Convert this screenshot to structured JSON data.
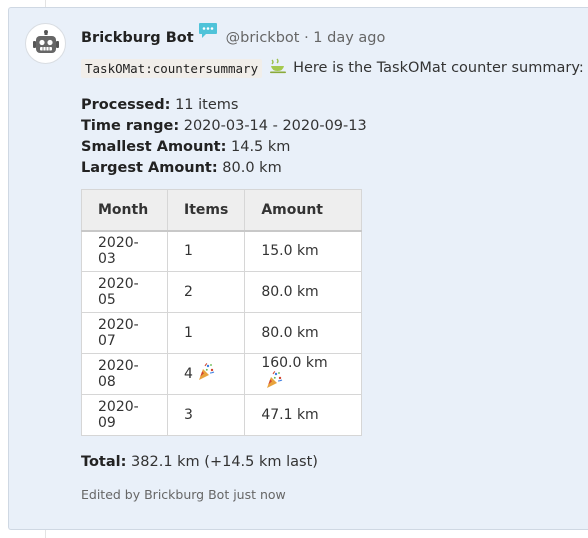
{
  "post": {
    "author": "Brickburg Bot",
    "handle_time": "@brickbot · 1 day ago",
    "command": "TaskOMat:countersummary",
    "message": "Here is the TaskOMat counter summary:",
    "stats": [
      {
        "label": "Processed:",
        "value": "11 items"
      },
      {
        "label": "Time range:",
        "value": "2020-03-14 - 2020-09-13"
      },
      {
        "label": "Smallest Amount:",
        "value": "14.5 km"
      },
      {
        "label": "Largest Amount:",
        "value": "80.0 km"
      }
    ],
    "table": {
      "headers": [
        "Month",
        "Items",
        "Amount"
      ],
      "rows": [
        {
          "month": "2020-03",
          "items": "1",
          "amount": "15.0 km",
          "celebrate": false
        },
        {
          "month": "2020-05",
          "items": "2",
          "amount": "80.0 km",
          "celebrate": false
        },
        {
          "month": "2020-07",
          "items": "1",
          "amount": "80.0 km",
          "celebrate": false
        },
        {
          "month": "2020-08",
          "items": "4",
          "amount": "160.0 km",
          "celebrate": true
        },
        {
          "month": "2020-09",
          "items": "3",
          "amount": "47.1 km",
          "celebrate": false
        }
      ]
    },
    "total_label": "Total:",
    "total_value": "382.1 km (+14.5 km last)",
    "edited_note": "Edited by Brickburg Bot just now"
  },
  "icons": {
    "avatar": "robot-icon",
    "badge": "chat-bubble-icon",
    "command": "tea-cup-icon",
    "celebrate": "party-popper-icon"
  },
  "colors": {
    "card_background": "#e9f0f9",
    "badge": "#4fc3d9",
    "table_header": "#eeeeee"
  }
}
